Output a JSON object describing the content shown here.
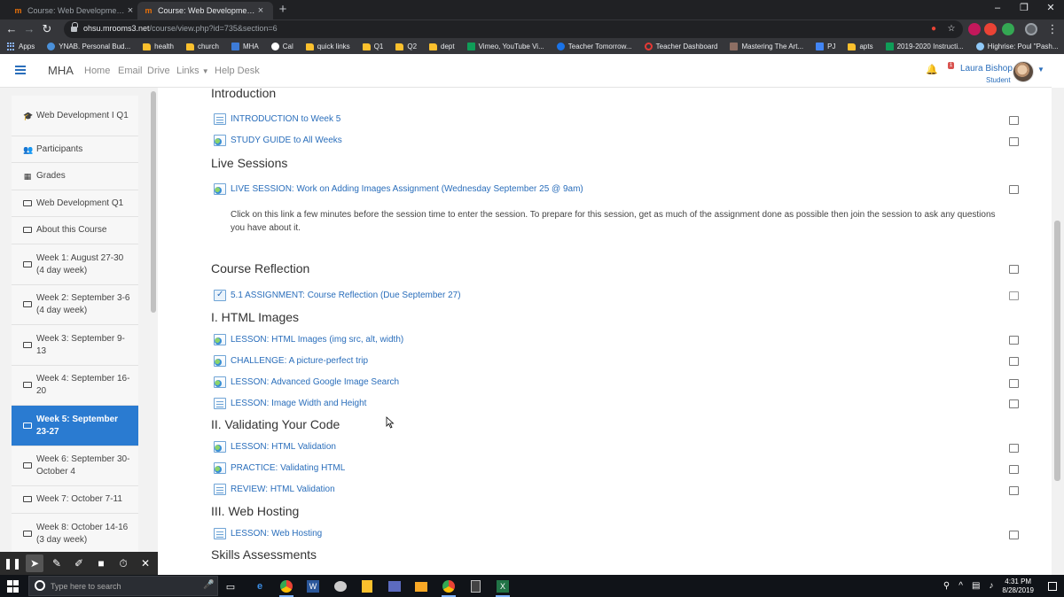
{
  "browser": {
    "tabs": [
      {
        "title": "Course: Web Development I Q1",
        "active": false
      },
      {
        "title": "Course: Web Development I Q1",
        "active": true
      }
    ],
    "url_host": "ohsu.mrooms3.net",
    "url_path": "/course/view.php?id=735&section=6",
    "bookmarks": [
      {
        "label": "Apps",
        "icon": "apps-grid-icon"
      },
      {
        "label": "YNAB. Personal Bud...",
        "icon": "ynab-icon"
      },
      {
        "label": "health",
        "icon": "folder-icon"
      },
      {
        "label": "church",
        "icon": "folder-icon"
      },
      {
        "label": "MHA",
        "icon": "mha-icon"
      },
      {
        "label": "Cal",
        "icon": "calendar-icon"
      },
      {
        "label": "quick links",
        "icon": "folder-icon"
      },
      {
        "label": "Q1",
        "icon": "folder-icon"
      },
      {
        "label": "Q2",
        "icon": "folder-icon"
      },
      {
        "label": "dept",
        "icon": "folder-icon"
      },
      {
        "label": "Vimeo, YouTube Vi...",
        "icon": "sheets-icon"
      },
      {
        "label": "Teacher Tomorrow...",
        "icon": "link-icon"
      },
      {
        "label": "Teacher Dashboard",
        "icon": "dashboard-icon"
      },
      {
        "label": "Mastering The Art...",
        "icon": "tw-icon"
      },
      {
        "label": "PJ",
        "icon": "docs-icon"
      },
      {
        "label": "apts",
        "icon": "folder-icon"
      },
      {
        "label": "2019-2020 Instructi...",
        "icon": "sheets-icon"
      },
      {
        "label": "Highrise: Poul \"Pash...",
        "icon": "highrise-icon"
      }
    ]
  },
  "header": {
    "brand": "MHA",
    "nav": [
      "Home",
      "Email",
      "Drive",
      "Links",
      "Help Desk"
    ],
    "user_name": "Laura Bishop",
    "user_role": "Student",
    "message_count": "1"
  },
  "sidebar": {
    "items": [
      {
        "label": "Web Development I Q1",
        "icon": "graduation-cap-icon"
      },
      {
        "label": "Participants",
        "icon": "users-icon"
      },
      {
        "label": "Grades",
        "icon": "table-icon"
      },
      {
        "label": "Web Development Q1",
        "icon": "folder-icon"
      },
      {
        "label": "About this Course",
        "icon": "folder-icon"
      },
      {
        "label": "Week 1: August 27-30 (4 day week)",
        "icon": "folder-icon"
      },
      {
        "label": "Week 2: September 3-6 (4 day week)",
        "icon": "folder-icon"
      },
      {
        "label": "Week 3: September 9-13",
        "icon": "folder-icon"
      },
      {
        "label": "Week 4: September 16-20",
        "icon": "folder-icon"
      },
      {
        "label": "Week 5: September 23-27",
        "icon": "folder-icon",
        "active": true
      },
      {
        "label": "Week 6: September 30-October 4",
        "icon": "folder-icon"
      },
      {
        "label": "Week 7: October 7-11",
        "icon": "folder-icon"
      },
      {
        "label": "Week 8: October 14-16 (3 day week)",
        "icon": "folder-icon"
      }
    ]
  },
  "main": {
    "sections": {
      "introduction": "Introduction",
      "live_sessions": "Live Sessions",
      "course_reflection": "Course Reflection",
      "html_images": "I. HTML Images",
      "validating": "II. Validating Your Code",
      "web_hosting": "III. Web Hosting",
      "skills": "Skills Assessments"
    },
    "activities": {
      "intro_week5": "INTRODUCTION to Week 5",
      "study_guide": "STUDY GUIDE to All Weeks",
      "live_session": "LIVE SESSION: Work on Adding Images Assignment (Wednesday September 25 @ 9am)",
      "reflection": "5.1 ASSIGNMENT: Course Reflection (Due September 27)",
      "lesson_images": "LESSON: HTML Images (img src, alt, width)",
      "challenge_trip": "CHALLENGE: A picture-perfect trip",
      "lesson_google": "LESSON: Advanced Google Image Search",
      "lesson_width": "LESSON: Image Width and Height",
      "lesson_validation": "LESSON: HTML Validation",
      "practice_validating": "PRACTICE: Validating HTML",
      "review_validation": "REVIEW: HTML Validation",
      "lesson_hosting": "LESSON: Web Hosting"
    },
    "live_session_description": "Click on this link a few minutes before the session time to enter the session. To prepare for this session, get as much of the assignment done as possible then join the session to ask any questions you have about it."
  },
  "taskbar": {
    "search_placeholder": "Type here to search",
    "time": "4:31 PM",
    "date": "8/28/2019"
  },
  "colors": {
    "accent": "#2a7bd1",
    "link": "#2a6ebb",
    "chrome_dark": "#202124"
  }
}
